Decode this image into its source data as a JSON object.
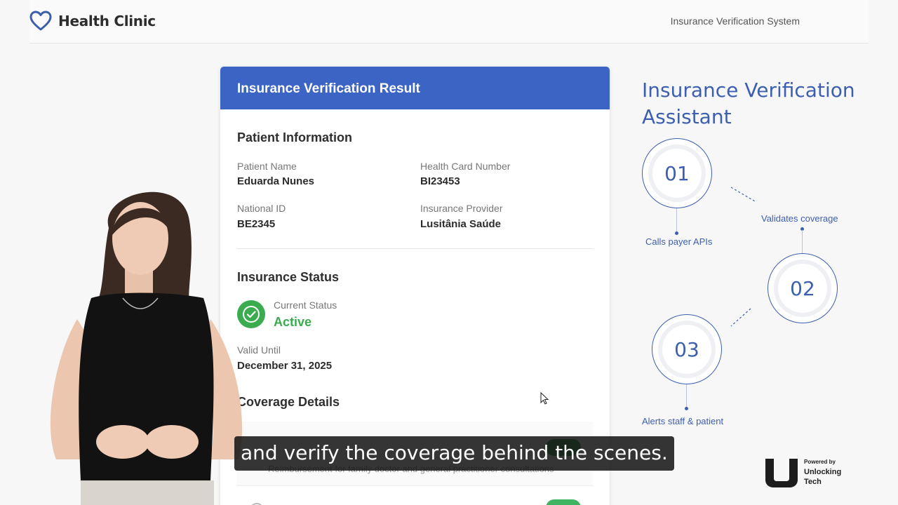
{
  "header": {
    "brand_name": "Health Clinic",
    "system_title": "Insurance Verification System"
  },
  "card": {
    "title": "Insurance Verification Result",
    "patient_section": "Patient Information",
    "fields": {
      "patient_name_label": "Patient Name",
      "patient_name": "Eduarda Nunes",
      "health_card_label": "Health Card Number",
      "health_card": "BI23453",
      "national_id_label": "National ID",
      "national_id": "BE2345",
      "provider_label": "Insurance Provider",
      "provider": "Lusitânia Saúde"
    },
    "status_section": "Insurance Status",
    "current_status_label": "Current Status",
    "current_status": "Active",
    "valid_until_label": "Valid Until",
    "valid_until": "December 31, 2025",
    "coverage_section": "Coverage Details",
    "coverage_item_description": "Reimbursement for family doctor and general practitioner consultations"
  },
  "assistant": {
    "title": "Insurance Verification Assistant",
    "steps": [
      {
        "number": "01",
        "label": "Calls payer APIs"
      },
      {
        "number": "02",
        "label": "Validates coverage"
      },
      {
        "number": "03",
        "label": "Alerts staff & patient"
      }
    ]
  },
  "subtitle": "and verify the coverage behind the scenes.",
  "powered": {
    "by": "Powered by",
    "name": "Unlocking Tech"
  },
  "colors": {
    "primary": "#3b64c4",
    "status_active": "#3aab4f",
    "assistant_accent": "#3d5fb0"
  }
}
